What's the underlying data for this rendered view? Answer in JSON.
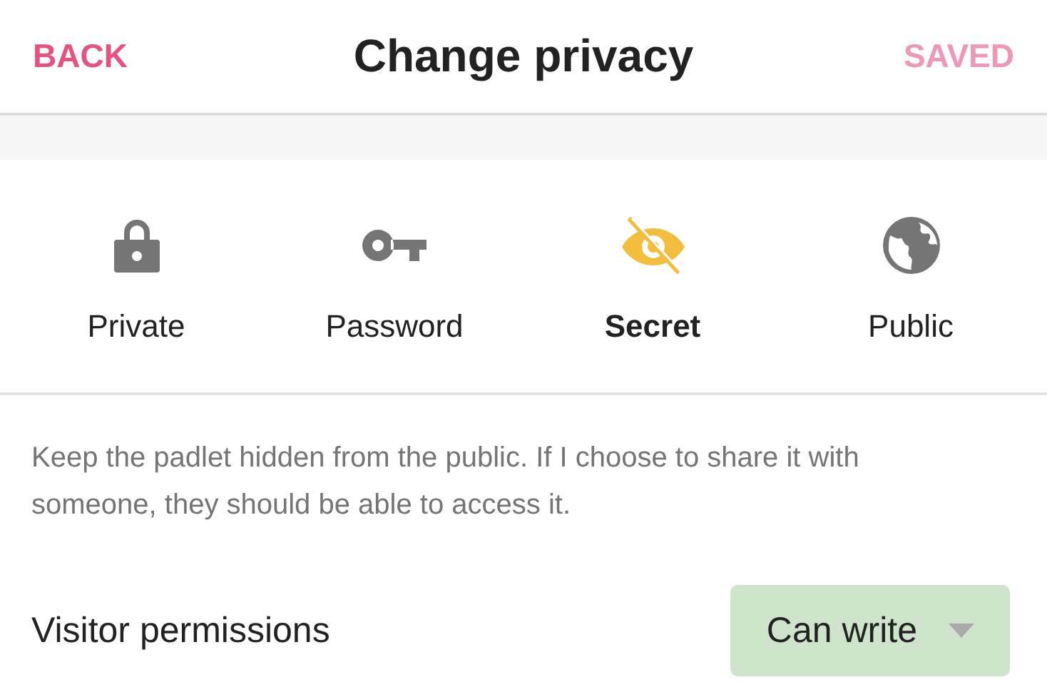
{
  "header": {
    "back": "BACK",
    "title": "Change privacy",
    "save": {
      "label": "SAVED",
      "disabled": true
    }
  },
  "options": [
    {
      "kind": "lock",
      "label": "Private",
      "selected": false
    },
    {
      "kind": "key",
      "label": "Password",
      "selected": false
    },
    {
      "kind": "eye-off",
      "label": "Secret",
      "selected": true
    },
    {
      "kind": "globe",
      "label": "Public",
      "selected": false
    }
  ],
  "description": "Keep the padlet hidden from the public. If I choose to share it with someone, they should be able to access it.",
  "permissions": {
    "label": "Visitor permissions",
    "value": "Can write"
  }
}
